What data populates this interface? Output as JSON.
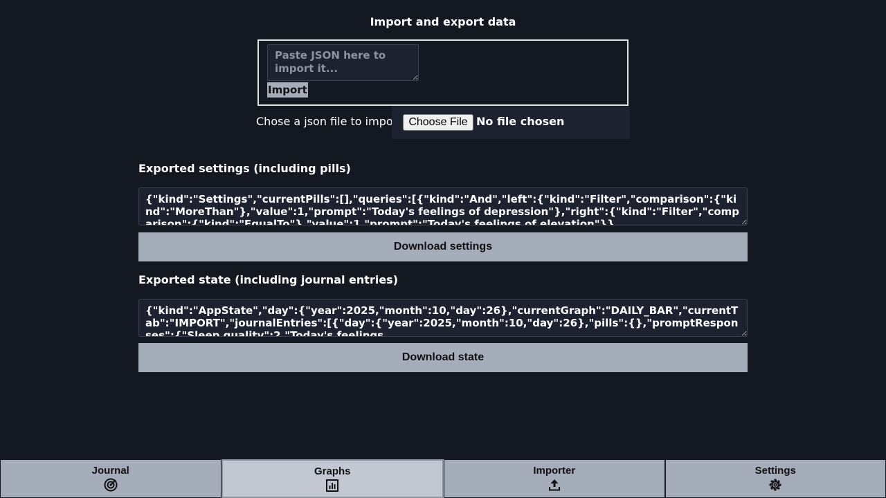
{
  "page": {
    "title": "Import and export data"
  },
  "import": {
    "placeholder": "Paste JSON here to import it...",
    "button_label": "Import",
    "file_label": "Chose a json file to import",
    "choose_button": "Choose File",
    "file_status": "No file chosen"
  },
  "settings_export": {
    "heading": "Exported settings (including pills)",
    "value": "{\"kind\":\"Settings\",\"currentPills\":[],\"queries\":[{\"kind\":\"And\",\"left\":{\"kind\":\"Filter\",\"comparison\":{\"kind\":\"MoreThan\"},\"value\":1,\"prompt\":\"Today's feelings of depression\"},\"right\":{\"kind\":\"Filter\",\"comparison\":{\"kind\":\"EqualTo\"},\"value\":1,\"prompt\":\"Today's feelings of elevation\"}}",
    "download_label": "Download settings"
  },
  "state_export": {
    "heading": "Exported state (including journal entries)",
    "value": "{\"kind\":\"AppState\",\"day\":{\"year\":2025,\"month\":10,\"day\":26},\"currentGraph\":\"DAILY_BAR\",\"currentTab\":\"IMPORT\",\"journalEntries\":[{\"day\":{\"year\":2025,\"month\":10,\"day\":26},\"pills\":{},\"promptResponses\":{\"Sleep quality\":2,\"Today's feelings",
    "download_label": "Download state"
  },
  "nav": {
    "tabs": [
      {
        "label": "Journal",
        "icon": "journal-icon",
        "active": false
      },
      {
        "label": "Graphs",
        "icon": "bar-chart-icon",
        "active": true
      },
      {
        "label": "Importer",
        "icon": "upload-icon",
        "active": false
      },
      {
        "label": "Settings",
        "icon": "gear-icon",
        "active": false
      }
    ]
  },
  "colors": {
    "background": "#141820",
    "button": "#a6adba",
    "active_tab": "#c3c7d1",
    "field": "#1c2230"
  }
}
